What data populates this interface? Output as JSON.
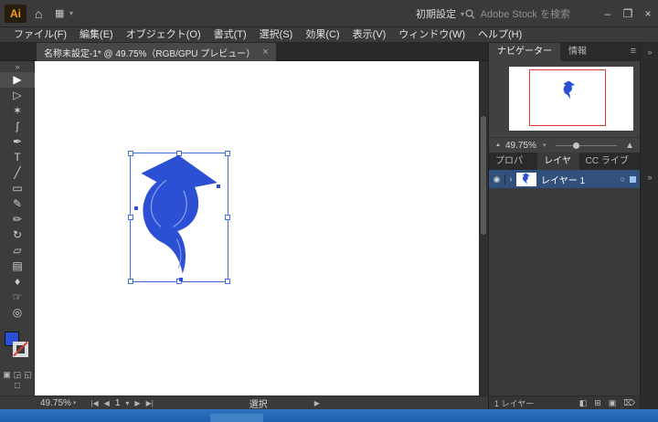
{
  "colors": {
    "accent_blue": "#2b50d4",
    "selection_blue": "#3f6fe0",
    "artboard_red": "#e0392e",
    "layer_selected_bg": "#31517c"
  },
  "titlebar": {
    "logo": "Ai",
    "workspace_label": "初期設定",
    "search_placeholder": "Adobe Stock を検索",
    "minimize": "–",
    "maximize": "❐",
    "close": "×"
  },
  "menubar": {
    "items": [
      "ファイル(F)",
      "編集(E)",
      "オブジェクト(O)",
      "書式(T)",
      "選択(S)",
      "効果(C)",
      "表示(V)",
      "ウィンドウ(W)",
      "ヘルプ(H)"
    ]
  },
  "document": {
    "tab_title": "名称未設定-1* @ 49.75%（RGB/GPU プレビュー）",
    "tab_close": "×"
  },
  "toolbar": {
    "collapse_icon": "»",
    "tools": [
      {
        "name": "selection-tool",
        "glyph": "▶"
      },
      {
        "name": "direct-selection-tool",
        "glyph": "▷"
      },
      {
        "name": "magic-wand-tool",
        "glyph": "✶"
      },
      {
        "name": "lasso-tool",
        "glyph": "ʃ"
      },
      {
        "name": "pen-tool",
        "glyph": "✒"
      },
      {
        "name": "type-tool",
        "glyph": "T"
      },
      {
        "name": "line-segment-tool",
        "glyph": "╱"
      },
      {
        "name": "rectangle-tool",
        "glyph": "▭"
      },
      {
        "name": "paintbrush-tool",
        "glyph": "✎"
      },
      {
        "name": "pencil-tool",
        "glyph": "✏"
      },
      {
        "name": "rotate-tool",
        "glyph": "↻"
      },
      {
        "name": "scale-tool",
        "glyph": "▱"
      },
      {
        "name": "gradient-tool",
        "glyph": "▤"
      },
      {
        "name": "eyedropper-tool",
        "glyph": "♦"
      },
      {
        "name": "hand-tool",
        "glyph": "☞"
      },
      {
        "name": "zoom-tool",
        "glyph": "◎"
      }
    ],
    "draw_modes": [
      "▣",
      "◲",
      "◱"
    ],
    "screen_mode": "□"
  },
  "statusbar": {
    "zoom": "49.75%",
    "artboard_number": "1",
    "status_label": "選択"
  },
  "navigator": {
    "tab_navigator": "ナビゲーター",
    "tab_info": "情報",
    "zoom_value": "49.75%"
  },
  "panels": {
    "tab_properties": "プロパティ",
    "tab_layers": "レイヤー",
    "tab_libraries": "CC ライブラリ"
  },
  "layers": {
    "rows": [
      {
        "name": "レイヤー 1"
      }
    ],
    "footer_count": "1 レイヤー"
  },
  "icons": {
    "home": "⌂",
    "grid": "▦",
    "caret": "▾",
    "menu": "≡",
    "collapse": "»",
    "eye": "◉",
    "chevron_right": "›",
    "target": "○",
    "first": "|◀",
    "prev": "◀",
    "next": "▶",
    "last": "▶|",
    "flyout": "▶",
    "mountain_small": "▲",
    "mountain_large": "▲",
    "mask": "◧",
    "new_sublayer": "⊞",
    "new_layer": "▣",
    "delete": "⌦"
  }
}
